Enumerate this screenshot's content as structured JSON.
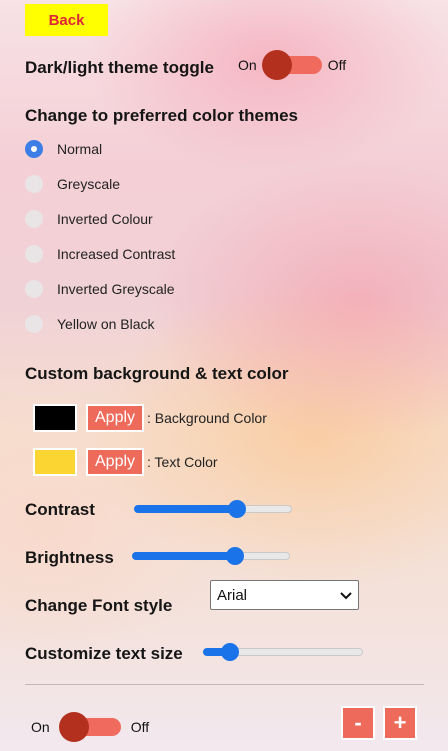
{
  "back_label": "Back",
  "theme_toggle": {
    "heading": "Dark/light theme toggle",
    "on_label": "On",
    "off_label": "Off"
  },
  "color_themes": {
    "heading": "Change to preferred color themes",
    "options": [
      "Normal",
      "Greyscale",
      "Inverted Colour",
      "Increased Contrast",
      "Inverted Greyscale",
      "Yellow on Black"
    ],
    "selected": "Normal"
  },
  "custom_colors": {
    "heading": "Custom background & text color",
    "background": {
      "swatch_color": "#000000",
      "apply_label": "Apply",
      "caption": ": Background Color"
    },
    "text": {
      "swatch_color": "#fbd633",
      "apply_label": "Apply",
      "caption": ": Text Color"
    }
  },
  "contrast": {
    "label": "Contrast",
    "value_fraction": 0.65
  },
  "brightness": {
    "label": "Brightness",
    "value_fraction": 0.65
  },
  "font_style": {
    "label": "Change Font style",
    "selected": "Arial"
  },
  "text_size": {
    "label": "Customize text size",
    "value_fraction": 0.17
  },
  "bottom_toggle": {
    "on_label": "On",
    "off_label": "Off"
  },
  "text_size_buttons": {
    "minus": "-",
    "plus": "+"
  },
  "colors": {
    "accent": "#ee6b5c",
    "toggle_knob": "#b3301f",
    "back_button_bg": "#ffff00",
    "slider": "#1a73e8"
  }
}
